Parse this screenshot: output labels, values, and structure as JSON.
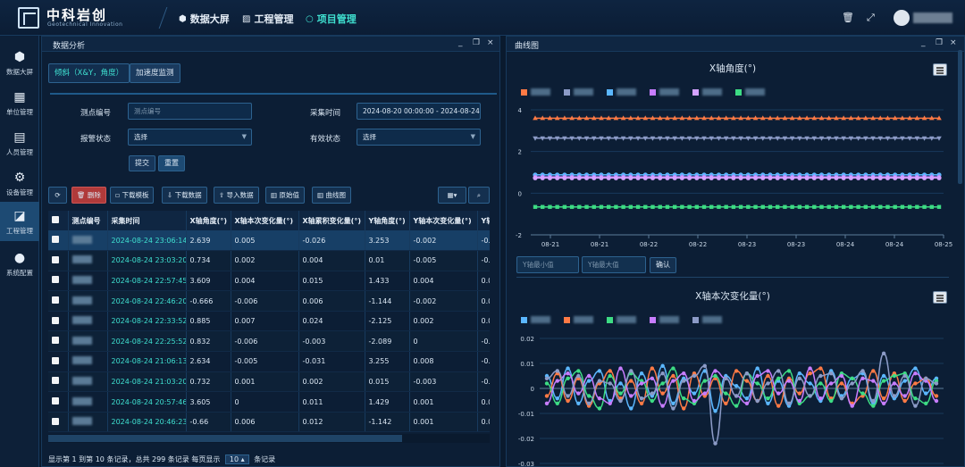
{
  "header": {
    "brand": "中科岩创",
    "brand_sub": "Geotechnical Innovation",
    "nav": [
      {
        "label": "数据大屏",
        "icon": "cube-icon",
        "active": false
      },
      {
        "label": "工程管理",
        "icon": "chart-icon",
        "active": false
      },
      {
        "label": "项目管理",
        "icon": "circle-icon",
        "active": true
      }
    ]
  },
  "sidebar": {
    "items": [
      {
        "label": "数据大屏",
        "icon": "cube-icon"
      },
      {
        "label": "单位管理",
        "icon": "calendar-check-icon"
      },
      {
        "label": "人员管理",
        "icon": "user-card-icon"
      },
      {
        "label": "设备管理",
        "icon": "gear-icon"
      },
      {
        "label": "工程管理",
        "icon": "area-chart-icon",
        "active": true
      },
      {
        "label": "系统配置",
        "icon": "dots-icon"
      }
    ]
  },
  "left_panel": {
    "title": "数据分析",
    "tabs": [
      "倾斜（X&Y，角度）",
      "加速度监测"
    ],
    "filters": {
      "point_label": "测点编号",
      "point_placeholder": "测点编号",
      "time_label": "采集时间",
      "time_value": "2024-08-20 00:00:00 - 2024-08-24 2",
      "alarm_label": "报警状态",
      "alarm_value": "选择",
      "valid_label": "有效状态",
      "valid_value": "选择",
      "submit": "提交",
      "reset": "重置"
    },
    "toolbar": {
      "delete": "删除",
      "download_template": "下载模板",
      "download_data": "下载数据",
      "import_data": "导入数据",
      "raw_value": "原始值",
      "curve_chart": "曲线图"
    },
    "table": {
      "columns": [
        "测点编号",
        "采集时间",
        "X轴角度(°)",
        "X轴本次变化量(°)",
        "X轴累积变化量(°)",
        "Y轴角度(°)",
        "Y轴本次变化量(°)",
        "Y轴"
      ],
      "rows": [
        [
          "2024-08-24 23:06:14",
          "2.639",
          "0.005",
          "-0.026",
          "3.253",
          "-0.002",
          "-0."
        ],
        [
          "2024-08-24 23:03:20",
          "0.734",
          "0.002",
          "0.004",
          "0.01",
          "-0.005",
          "-0."
        ],
        [
          "2024-08-24 22:57:45",
          "3.609",
          "0.004",
          "0.015",
          "1.433",
          "0.004",
          "0.0"
        ],
        [
          "2024-08-24 22:46:20",
          "-0.666",
          "-0.006",
          "0.006",
          "-1.144",
          "-0.002",
          "0.0"
        ],
        [
          "2024-08-24 22:33:52",
          "0.885",
          "0.007",
          "0.024",
          "-2.125",
          "0.002",
          "0.0"
        ],
        [
          "2024-08-24 22:25:52",
          "0.832",
          "-0.006",
          "-0.003",
          "-2.089",
          "0",
          "-0."
        ],
        [
          "2024-08-24 21:06:13",
          "2.634",
          "-0.005",
          "-0.031",
          "3.255",
          "0.008",
          "-0."
        ],
        [
          "2024-08-24 21:03:20",
          "0.732",
          "0.001",
          "0.002",
          "0.015",
          "-0.003",
          "-0."
        ],
        [
          "2024-08-24 20:57:46",
          "3.605",
          "0",
          "0.011",
          "1.429",
          "0.001",
          "0.0"
        ],
        [
          "2024-08-24 20:46:23",
          "-0.66",
          "0.006",
          "0.012",
          "-1.142",
          "0.001",
          "0.0"
        ]
      ]
    },
    "pager": {
      "text": "显示第 1 到第 10 条记录，总共 299 条记录  每页显示",
      "page_size": "10",
      "suffix": "条记录"
    }
  },
  "right_panel": {
    "title": "曲线图",
    "y_min_placeholder": "Y轴最小值",
    "y_max_placeholder": "Y轴最大值",
    "confirm": "确认"
  },
  "chart_data": [
    {
      "type": "line",
      "title": "X轴角度(°)",
      "x": [
        "08-21",
        "08-21",
        "08-22",
        "08-22",
        "08-23",
        "08-23",
        "08-24",
        "08-24",
        "08-25"
      ],
      "ylim": [
        -2,
        4
      ],
      "yticks": [
        -2,
        0,
        2,
        4
      ],
      "grid": true,
      "series": [
        {
          "color": "#ff7a45",
          "marker": "triangle",
          "values": [
            3.6,
            3.6,
            3.6,
            3.6,
            3.6,
            3.6,
            3.6,
            3.6,
            3.6
          ]
        },
        {
          "color": "#8c9bc7",
          "marker": "triangle-down",
          "values": [
            2.64,
            2.64,
            2.64,
            2.64,
            2.64,
            2.64,
            2.64,
            2.64,
            2.64
          ]
        },
        {
          "color": "#5bb7ff",
          "marker": "circle",
          "values": [
            0.88,
            0.88,
            0.88,
            0.88,
            0.88,
            0.88,
            0.88,
            0.88,
            0.88
          ]
        },
        {
          "color": "#c77dff",
          "marker": "diamond",
          "values": [
            0.78,
            0.78,
            0.78,
            0.78,
            0.78,
            0.78,
            0.78,
            0.78,
            0.78
          ]
        },
        {
          "color": "#d4a2ff",
          "marker": "circle",
          "values": [
            0.73,
            0.73,
            0.73,
            0.73,
            0.73,
            0.73,
            0.73,
            0.73,
            0.73
          ]
        },
        {
          "color": "#3ddc84",
          "marker": "square",
          "values": [
            -0.66,
            -0.66,
            -0.66,
            -0.66,
            -0.66,
            -0.66,
            -0.66,
            -0.66,
            -0.66
          ]
        }
      ]
    },
    {
      "type": "line",
      "title": "X轴本次变化量(°)",
      "ylim": [
        -0.03,
        0.02
      ],
      "yticks": [
        -0.03,
        -0.02,
        -0.01,
        0,
        0.01,
        0.02
      ],
      "grid": true,
      "series": [
        {
          "color": "#5bb7ff",
          "values": [
            0.005,
            -0.004,
            0.008,
            -0.006,
            0.003,
            0.007,
            -0.005,
            0.002,
            -0.008,
            0.006,
            -0.003,
            0.009,
            -0.006,
            0.004,
            -0.002,
            0.007,
            -0.009,
            0.005,
            0.001,
            -0.004,
            0.008,
            -0.006,
            0.003,
            -0.007,
            0.006,
            0.002,
            -0.005,
            0.007,
            -0.003,
            0.004,
            0.006,
            -0.006,
            0.005,
            -0.004,
            0.003,
            0.008,
            -0.002,
            0.004
          ]
        },
        {
          "color": "#ff7a45",
          "values": [
            -0.003,
            0.006,
            -0.005,
            0.004,
            -0.007,
            0.002,
            0.007,
            -0.004,
            0.003,
            -0.006,
            0.008,
            -0.002,
            0.005,
            -0.008,
            0.006,
            -0.003,
            0.004,
            -0.006,
            0.007,
            0.003,
            -0.005,
            0.005,
            -0.007,
            0.004,
            -0.002,
            0.006,
            0.008,
            -0.004,
            0.002,
            -0.006,
            -0.003,
            0.007,
            -0.004,
            0.006,
            -0.005,
            0.002,
            0.004,
            -0.003
          ]
        },
        {
          "color": "#3ddc84",
          "values": [
            0.002,
            -0.006,
            0.004,
            0.007,
            -0.003,
            -0.008,
            0.005,
            -0.002,
            0.006,
            0.003,
            -0.005,
            0.002,
            0.008,
            -0.004,
            -0.006,
            0.003,
            0.005,
            -0.002,
            -0.007,
            0.006,
            0.002,
            -0.004,
            0.004,
            0.007,
            -0.006,
            -0.003,
            0.002,
            -0.005,
            0.006,
            0.004,
            -0.002,
            -0.007,
            0.003,
            0.005,
            0.006,
            -0.004,
            -0.006,
            0.003
          ]
        },
        {
          "color": "#c77dff",
          "values": [
            -0.006,
            0.003,
            0.006,
            -0.002,
            0.005,
            -0.004,
            -0.006,
            0.008,
            -0.003,
            0.002,
            0.004,
            -0.007,
            0.003,
            0.006,
            -0.005,
            -0.002,
            0.007,
            0.004,
            -0.003,
            -0.006,
            0.005,
            0.007,
            -0.002,
            0.003,
            -0.005,
            0.008,
            -0.004,
            0.002,
            0.005,
            -0.007,
            0.004,
            0.003,
            -0.006,
            0.002,
            -0.003,
            0.006,
            0.003,
            -0.005
          ]
        },
        {
          "color": "#8c9bc7",
          "values": [
            0.004,
            0.007,
            -0.003,
            0.005,
            -0.006,
            0.003,
            0.002,
            -0.005,
            0.007,
            -0.004,
            -0.002,
            0.006,
            -0.008,
            0.003,
            0.005,
            0.009,
            -0.022,
            0.004,
            -0.003,
            0.006,
            -0.005,
            0.002,
            0.007,
            -0.006,
            0.004,
            -0.003,
            0.005,
            0.006,
            -0.004,
            0.002,
            0.007,
            -0.005,
            0.014,
            -0.003,
            0.005,
            -0.007,
            0.004,
            0.002
          ]
        }
      ]
    }
  ]
}
